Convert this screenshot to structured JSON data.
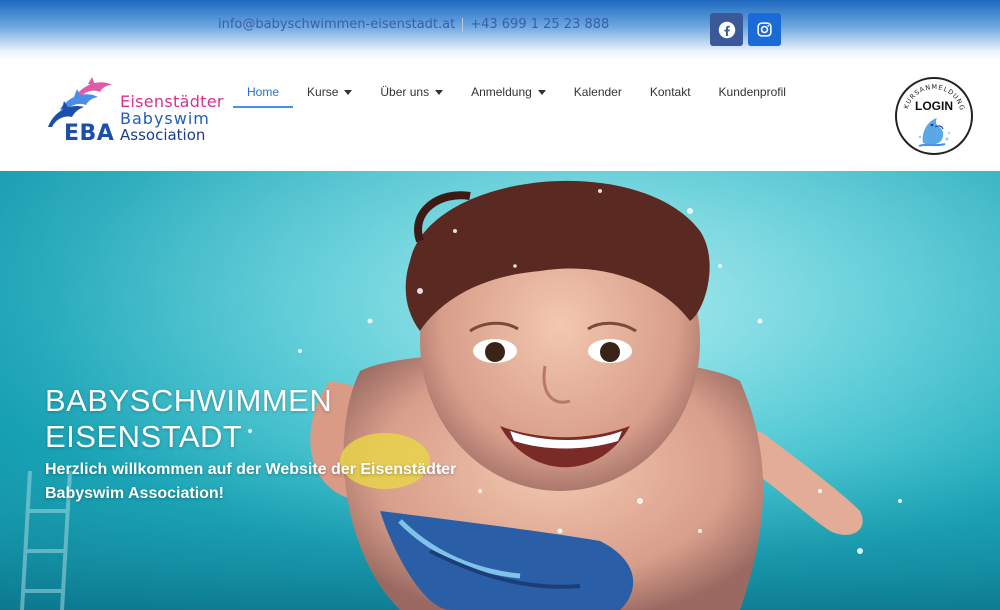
{
  "topbar": {
    "email": "info@babyschwimmen-eisenstadt.at",
    "phone": "+43 699 1 25 23 888",
    "social": [
      {
        "icon": "facebook-icon",
        "color": "#3b5998"
      },
      {
        "icon": "instagram-icon",
        "color": "#1a6bd8"
      }
    ]
  },
  "logo": {
    "line1": "Eisenstädter",
    "line2": "Babyswim",
    "line3": "Association",
    "abbr": "EBA"
  },
  "nav": {
    "items": [
      {
        "label": "Home",
        "active": true,
        "dropdown": false
      },
      {
        "label": "Kurse",
        "active": false,
        "dropdown": true
      },
      {
        "label": "Über uns",
        "active": false,
        "dropdown": true
      },
      {
        "label": "Anmeldung",
        "active": false,
        "dropdown": true
      },
      {
        "label": "Kalender",
        "active": false,
        "dropdown": false
      },
      {
        "label": "Kontakt",
        "active": false,
        "dropdown": false
      },
      {
        "label": "Kundenprofil",
        "active": false,
        "dropdown": false
      }
    ],
    "accent": "#2b6fd0"
  },
  "login_badge": {
    "ring_text": "KURSANMELDUNG",
    "label": "LOGIN"
  },
  "hero": {
    "title_line1": "BABYSCHWIMMEN",
    "title_line2": "EISENSTADT",
    "subtitle_line1": "Herzlich willkommen auf der Website der Eisenstädter",
    "subtitle_line2": "Babyswim Association!",
    "image": "child-swimming-underwater-photo"
  }
}
